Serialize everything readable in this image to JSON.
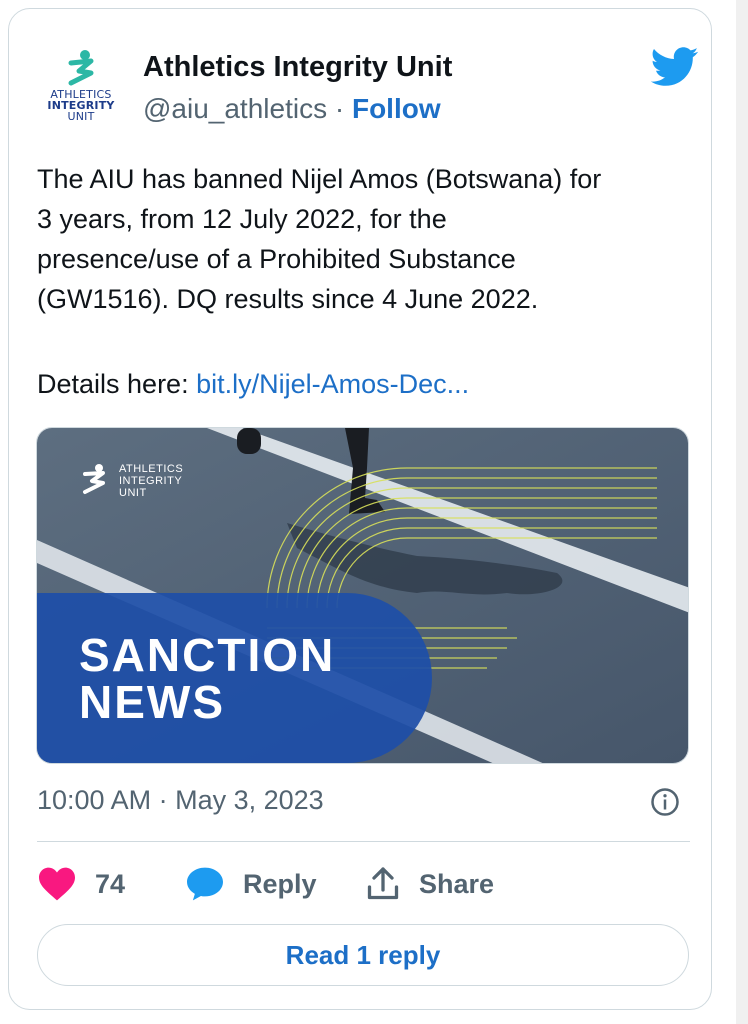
{
  "tweet": {
    "author_name": "Athletics Integrity Unit",
    "handle": "@aiu_athletics",
    "separator": "·",
    "follow_label": "Follow",
    "avatar_words": [
      "ATHLETICS",
      "INTEGRITY",
      "UNIT"
    ],
    "text_lines": [
      "The AIU has banned Nijel Amos (Botswana) for",
      "3 years, from 12 July 2022, for the",
      "presence/use of a Prohibited Substance",
      "(GW1516). DQ results since 4 June 2022."
    ],
    "details_prefix": "Details here: ",
    "details_link": "bit.ly/Nijel-Amos-Dec...",
    "timestamp": "10:00 AM · May 3, 2023"
  },
  "media": {
    "logo_words": [
      "ATHLETICS",
      "INTEGRITY",
      "UNIT"
    ],
    "headline_line1": "SANCTION",
    "headline_line2": "NEWS"
  },
  "actions": {
    "like_count": "74",
    "reply_label": "Reply",
    "share_label": "Share",
    "read_reply_label": "Read 1 reply"
  },
  "colors": {
    "link_blue": "#1d6fc7",
    "twitter_blue": "#1d9bf0",
    "like_pink": "#f91880",
    "muted_gray": "#536471",
    "banner_blue": "#1e4fa8"
  },
  "icons": [
    "twitter-bird-icon",
    "info-icon",
    "heart-icon",
    "reply-bubble-icon",
    "share-icon"
  ]
}
